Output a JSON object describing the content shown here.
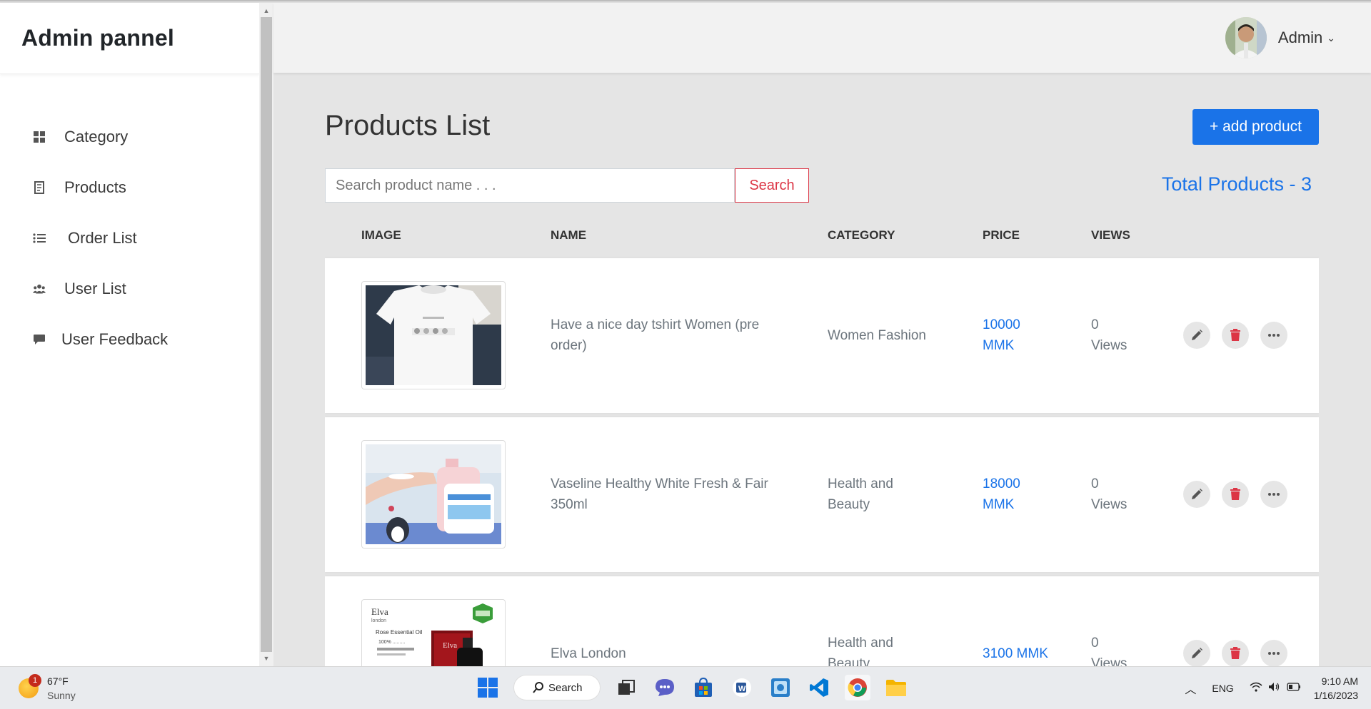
{
  "sidebar": {
    "brand": "Admin pannel",
    "items": [
      {
        "label": "Category",
        "icon": "grid-icon"
      },
      {
        "label": "Products",
        "icon": "receipt-icon"
      },
      {
        "label": "Order List",
        "icon": "list-icon"
      },
      {
        "label": "User List",
        "icon": "users-icon"
      },
      {
        "label": "User Feedback",
        "icon": "comment-icon"
      }
    ]
  },
  "header": {
    "user_name": "Admin"
  },
  "main": {
    "title": "Products List",
    "add_button": "+ add product",
    "search_placeholder": "Search product name . . .",
    "search_button": "Search",
    "total": "Total Products - 3",
    "columns": [
      "IMAGE",
      "NAME",
      "CATEGORY",
      "PRICE",
      "VIEWS"
    ],
    "products": [
      {
        "name": "Have a nice day tshirt Women (pre order)",
        "name_l1": "Have a nice day tshirt Women (pre",
        "name_l2": "order)",
        "category_l1": "Women Fashion",
        "category_l2": "",
        "price_l1": "10000",
        "price_l2": "MMK",
        "views_l1": "0",
        "views_l2": "Views",
        "image": "tshirt-image"
      },
      {
        "name": "Vaseline Healthy White Fresh & Fair 350ml",
        "name_l1": "Vaseline Healthy White Fresh & Fair",
        "name_l2": "350ml",
        "category_l1": "Health and",
        "category_l2": "Beauty",
        "price_l1": "18000",
        "price_l2": "MMK",
        "views_l1": "0",
        "views_l2": "Views",
        "image": "lotion-image"
      },
      {
        "name": "Elva London",
        "name_l1": "Elva London",
        "name_l2": "",
        "category_l1": "Health and",
        "category_l2": "Beauty",
        "price_l1": "3100 MMK",
        "price_l2": "",
        "views_l1": "0",
        "views_l2": "Views",
        "image": "oil-image"
      }
    ],
    "elva_image_text": {
      "brand": "Elva",
      "sub": "london",
      "product": "Rose Essential Oil",
      "pct": "100% ........."
    }
  },
  "taskbar": {
    "weather_temp": "67°F",
    "weather_cond": "Sunny",
    "weather_badge": "1",
    "search_label": "Search",
    "lang": "ENG",
    "time": "9:10 AM",
    "date": "1/16/2023"
  },
  "colors": {
    "accent": "#1a73e8",
    "danger": "#dc3545"
  }
}
